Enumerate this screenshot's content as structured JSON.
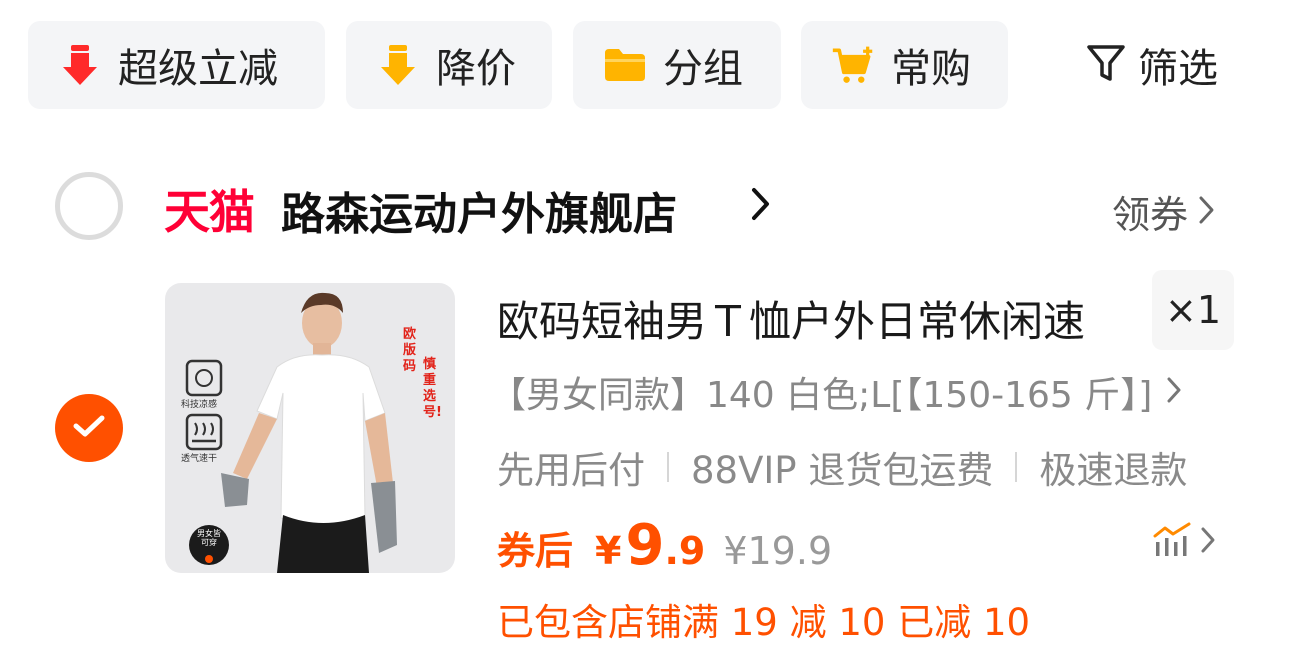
{
  "toolbar": {
    "chips": [
      {
        "label": "超级立减",
        "icon": "red-down-arrow-icon"
      },
      {
        "label": "降价",
        "icon": "yellow-down-arrow-icon"
      },
      {
        "label": "分组",
        "icon": "folder-icon"
      },
      {
        "label": "常购",
        "icon": "cart-plus-icon"
      }
    ],
    "filter_label": "筛选"
  },
  "store": {
    "platform": "天猫",
    "name": "路森运动户外旗舰店",
    "coupon_label": "领券"
  },
  "item": {
    "title": "欧码短袖男Ｔ恤户外日常休闲速",
    "quantity": "×1",
    "sku": "【男女同款】140 白色;L[【150-165 斤】]",
    "services": [
      "先用后付",
      "88VIP 退货包运费",
      "极速退款"
    ],
    "price_prefix": "券后",
    "currency": "¥",
    "price_int": "9",
    "price_dec": ".9",
    "original_price": "¥19.9",
    "promo": "已包含店铺满 19 减 10 已减 10",
    "thumbnail": {
      "badge_vertical_1": "欧版码",
      "badge_vertical_2": "慎重选号!",
      "feature_1": "科技凉感",
      "feature_2": "透气速干",
      "unisex_badge": "男女皆可穿"
    }
  },
  "colors": {
    "accent": "#ff5000",
    "tmall_red": "#ff0036",
    "chip_bg": "#f4f5f7"
  }
}
